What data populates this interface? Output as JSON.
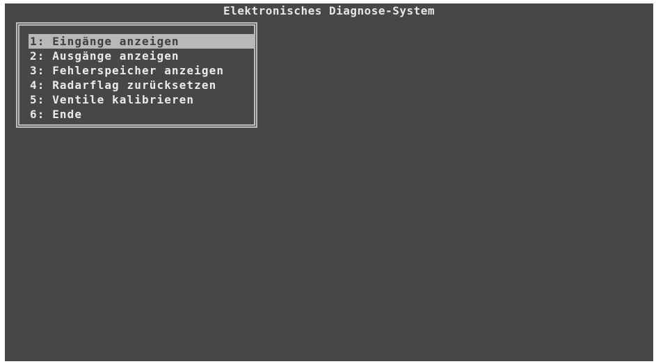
{
  "screen": {
    "title": "Elektronisches Diagnose-System"
  },
  "menu": {
    "selected_index": 0,
    "items": [
      {
        "label": "1: Eingänge anzeigen"
      },
      {
        "label": "2: Ausgänge anzeigen"
      },
      {
        "label": "3: Fehlerspeicher anzeigen"
      },
      {
        "label": "4: Radarflag zurücksetzen"
      },
      {
        "label": "5: Ventile kalibrieren"
      },
      {
        "label": "6: Ende"
      }
    ]
  },
  "colors": {
    "background": "#474747",
    "text": "#ebebeb",
    "highlight": "#b8b8b8",
    "border": "#bdbdbd"
  }
}
